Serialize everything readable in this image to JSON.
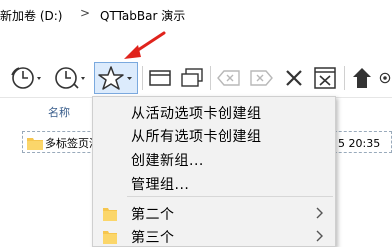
{
  "address": {
    "drive": "新加卷 (D:)",
    "separator": ">",
    "folder": "QTTabBar 演示"
  },
  "toolbar": {
    "buttons": [
      {
        "icon": "history-clock-dropdown-icon"
      },
      {
        "icon": "recent-clock-dropdown-icon"
      },
      {
        "icon": "favorites-star-dropdown-icon"
      },
      {
        "icon": "new-window-icon"
      },
      {
        "icon": "clone-window-icon"
      },
      {
        "icon": "backspace-left-icon"
      },
      {
        "icon": "backspace-right-icon"
      },
      {
        "icon": "close-x-icon"
      },
      {
        "icon": "close-window-icon"
      },
      {
        "icon": "up-arrow-icon"
      },
      {
        "icon": "settings-icon"
      }
    ]
  },
  "list": {
    "column_name": "名称",
    "selected_item_name": "多标签页演",
    "selected_item_date": "5 20:35"
  },
  "menu": {
    "items": [
      {
        "label": "从活动选项卡创建组"
      },
      {
        "label": "从所有选项卡创建组"
      },
      {
        "label": "创建新组..."
      },
      {
        "label": "管理组..."
      },
      {
        "label": "第二个"
      },
      {
        "label": "第三个"
      }
    ]
  },
  "colors": {
    "accent_red": "#e0231c",
    "folder_yellow": "#f6c64e",
    "highlight_blue": "#dcebfc"
  }
}
